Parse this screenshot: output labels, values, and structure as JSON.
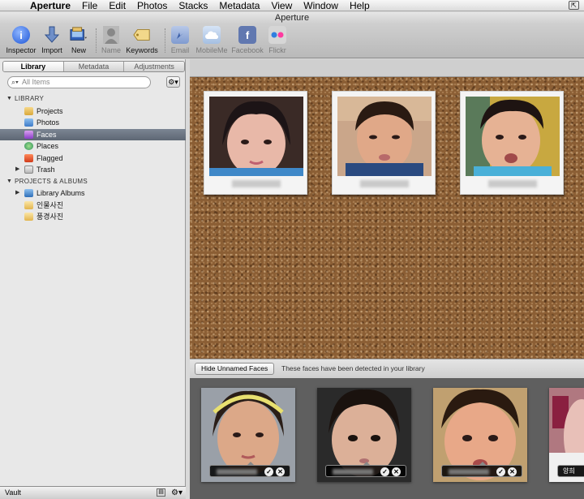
{
  "menubar": {
    "items": [
      "Aperture",
      "File",
      "Edit",
      "Photos",
      "Stacks",
      "Metadata",
      "View",
      "Window",
      "Help"
    ]
  },
  "window": {
    "title": "Aperture"
  },
  "toolbar": {
    "inspector": "Inspector",
    "import": "Import",
    "new": "New",
    "name": "Name",
    "keywords": "Keywords",
    "email": "Email",
    "mobileme": "MobileMe",
    "facebook": "Facebook",
    "flickr": "Flickr"
  },
  "tabs": [
    "Library",
    "Metadata",
    "Adjustments"
  ],
  "search": {
    "placeholder": "All Items"
  },
  "library": {
    "section_title": "LIBRARY",
    "items": [
      "Projects",
      "Photos",
      "Faces",
      "Places",
      "Flagged",
      "Trash"
    ],
    "projects_title": "PROJECTS & ALBUMS",
    "projects": [
      "Library Albums",
      "인물사진",
      "풍경사진"
    ]
  },
  "bottombar": {
    "vault": "Vault"
  },
  "unnamed": {
    "button": "Hide Unnamed Faces",
    "message": "These faces have been detected in your library",
    "partial_label": "양희"
  },
  "colors": {
    "accent_selected": "#5e6774",
    "cork": "#8b5e34",
    "strip_bg": "#5f5f5f"
  }
}
